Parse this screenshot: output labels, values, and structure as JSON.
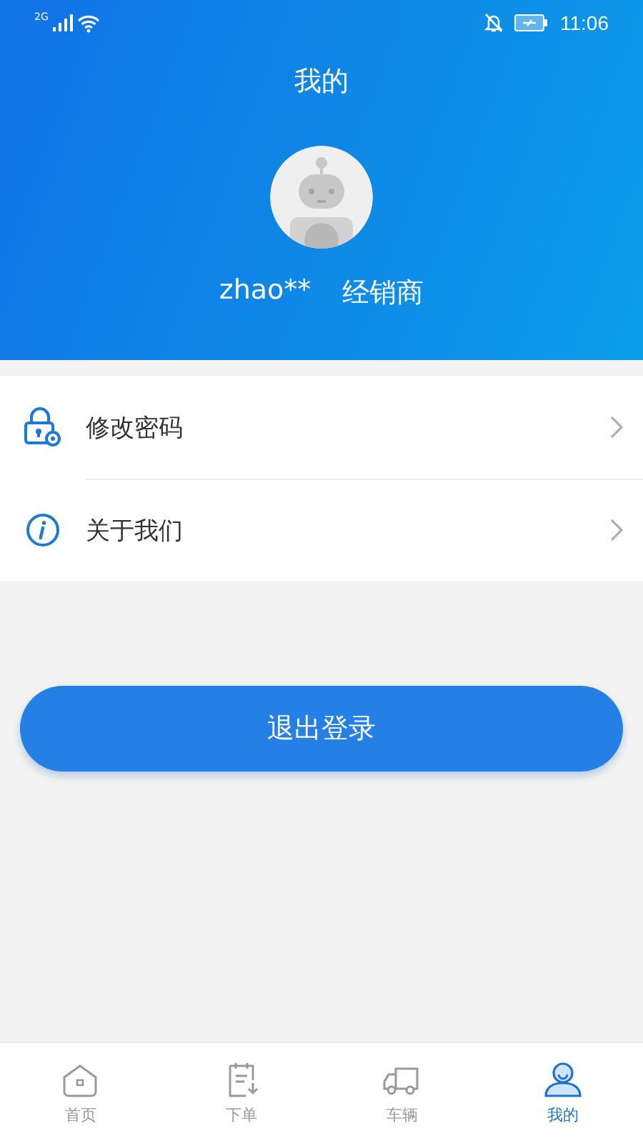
{
  "status_bar": {
    "network": "2G",
    "time": "11:06"
  },
  "header": {
    "title": "我的",
    "username": "zhao**",
    "role": "经销商"
  },
  "menu": [
    {
      "kind": "password",
      "label": "修改密码"
    },
    {
      "kind": "about",
      "label": "关于我们"
    }
  ],
  "logout_button": "退出登录",
  "tabs": [
    {
      "kind": "home",
      "label": "首页",
      "selected": false
    },
    {
      "kind": "order",
      "label": "下单",
      "selected": false
    },
    {
      "kind": "vehicle",
      "label": "车辆",
      "selected": false
    },
    {
      "kind": "profile",
      "label": "我的",
      "selected": true
    }
  ]
}
